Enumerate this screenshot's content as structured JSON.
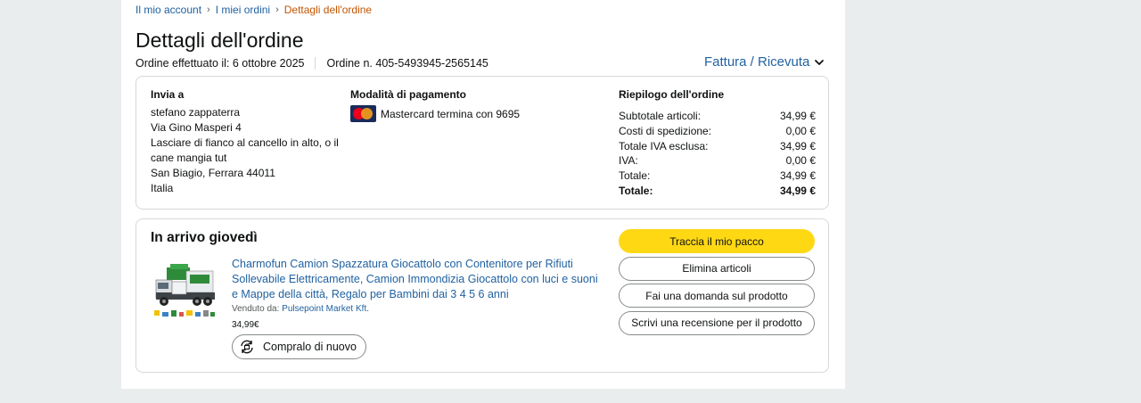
{
  "breadcrumb": {
    "items": [
      "Il mio account",
      "I miei ordini"
    ],
    "current": "Dettagli dell'ordine",
    "separator": "›"
  },
  "page_title": "Dettagli dell'ordine",
  "order_meta": {
    "placed": "Ordine effettuato il: 6 ottobre 2025",
    "number": "Ordine n. 405-5493945-2565145"
  },
  "invoice_link": "Fattura / Ricevuta",
  "shipping": {
    "header": "Invia a",
    "lines": [
      "stefano zappaterra",
      "Via Gino Masperi 4",
      "Lasciare di fianco al cancello in alto, o il cane mangia tut",
      "San Biagio, Ferrara 44011",
      "Italia"
    ]
  },
  "payment": {
    "header": "Modalità di pagamento",
    "method": "Mastercard termina con 9695",
    "icon": "mastercard-icon"
  },
  "summary": {
    "header": "Riepilogo dell'ordine",
    "rows": [
      {
        "label": "Subtotale articoli:",
        "value": "34,99 €",
        "bold": false
      },
      {
        "label": "Costi di spedizione:",
        "value": "0,00 €",
        "bold": false
      },
      {
        "label": "Totale IVA esclusa:",
        "value": "34,99 €",
        "bold": false
      },
      {
        "label": "IVA:",
        "value": "0,00 €",
        "bold": false
      },
      {
        "label": "Totale:",
        "value": "34,99 €",
        "bold": false
      },
      {
        "label": "Totale:",
        "value": "34,99 €",
        "bold": true
      }
    ]
  },
  "shipment": {
    "status": "In arrivo giovedì",
    "product": {
      "title": "Charmofun Camion Spazzatura Giocattolo con Contenitore per Rifiuti Sollevabile Elettricamente, Camion Immondizia Giocattolo con luci e suoni e Mappe della città, Regalo per Bambini dai 3 4 5 6 anni",
      "sold_by_label": "Venduto da:",
      "seller": "Pulsepoint Market Kft.",
      "price": "34,99€",
      "buy_again": "Compralo di nuovo"
    },
    "actions": {
      "track": "Traccia il mio pacco",
      "delete": "Elimina articoli",
      "ask": "Fai una domanda sul prodotto",
      "review": "Scrivi una recensione per il prodotto"
    }
  },
  "colors": {
    "link": "#2162a1",
    "current_crumb": "#c45500",
    "primary_button": "#ffd814",
    "page_bg": "#eaeded"
  }
}
